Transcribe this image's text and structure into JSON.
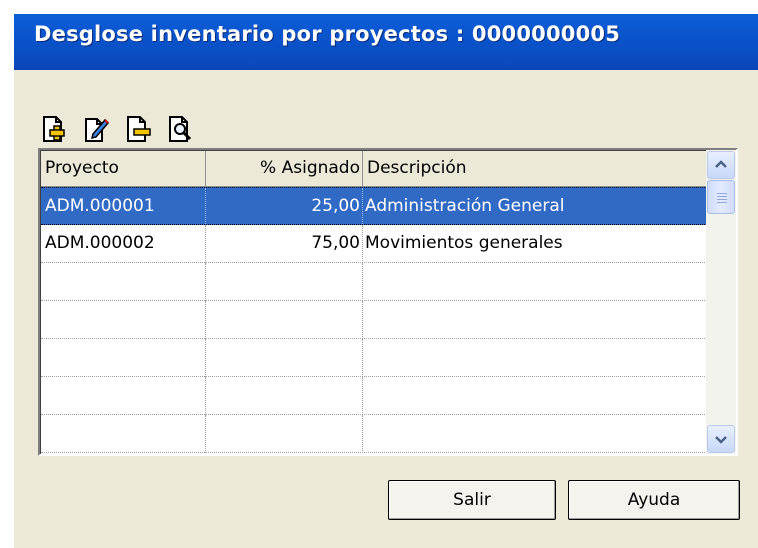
{
  "window": {
    "title": "Desglose inventario por proyectos : 0000000005"
  },
  "toolbar": {
    "buttons": [
      {
        "icon": "add-document-icon"
      },
      {
        "icon": "edit-document-icon"
      },
      {
        "icon": "remove-document-icon"
      },
      {
        "icon": "view-document-icon"
      }
    ]
  },
  "grid": {
    "columns": [
      "Proyecto",
      "% Asignado",
      "Descripción"
    ],
    "rows": [
      {
        "proyecto": "ADM.000001",
        "asignado": "25,00",
        "descripcion": "Administración General",
        "selected": true
      },
      {
        "proyecto": "ADM.000002",
        "asignado": "75,00",
        "descripcion": "Movimientos generales",
        "selected": false
      }
    ]
  },
  "buttons": {
    "exit": "Salir",
    "help": "Ayuda"
  },
  "colors": {
    "titlebar": "#0a50c8",
    "dialog": "#ece9d8",
    "selection": "#316ac5"
  }
}
